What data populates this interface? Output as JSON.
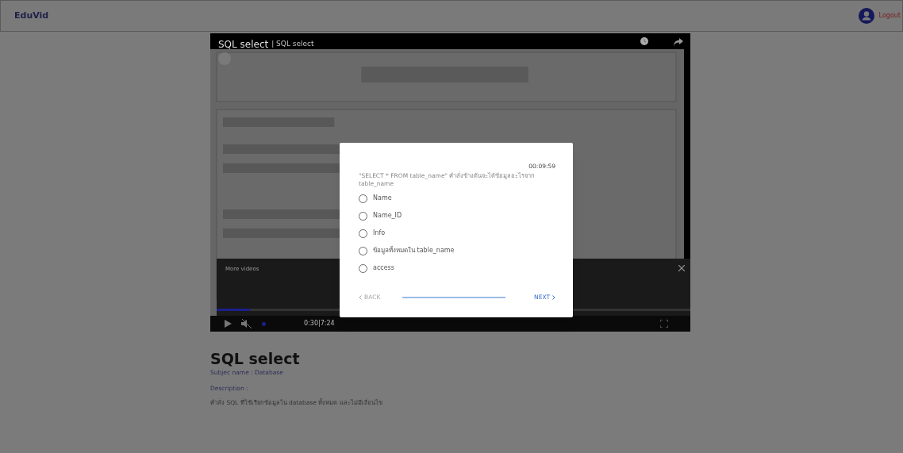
{
  "header": {
    "brand": "EduVid",
    "logout": "Logout"
  },
  "player": {
    "title": "SQL select",
    "subtitle": "| SQL select",
    "more_videos": "More videos",
    "time": "0:30|7:24",
    "muted": true,
    "progress": {
      "level": 0.07
    }
  },
  "quiz": {
    "timer": "00:09:59",
    "question": "\"SELECT * FROM table_name\" คำสั่งข้างต้นจะได้ข้อมูลอะไรจาก table_name",
    "options": [
      {
        "label": "Name",
        "selected": false
      },
      {
        "label": "Name_ID",
        "selected": false
      },
      {
        "label": "Info",
        "selected": false
      },
      {
        "label": "ข้อมูลทั้งหมดใน table_name",
        "selected": false
      },
      {
        "label": "access",
        "selected": false
      }
    ],
    "back": {
      "label": "BACK",
      "disabled": true
    },
    "next": {
      "label": "NEXT",
      "disabled": false
    }
  },
  "details": {
    "title": "SQL select",
    "subject": "Subjec name : Database",
    "description_label": "Description :",
    "description": "คำสั่ง SQL ที่ใช้เรียกข้อมูลใน database ทั้งหมด และไม่มีเงื่อนไข"
  }
}
